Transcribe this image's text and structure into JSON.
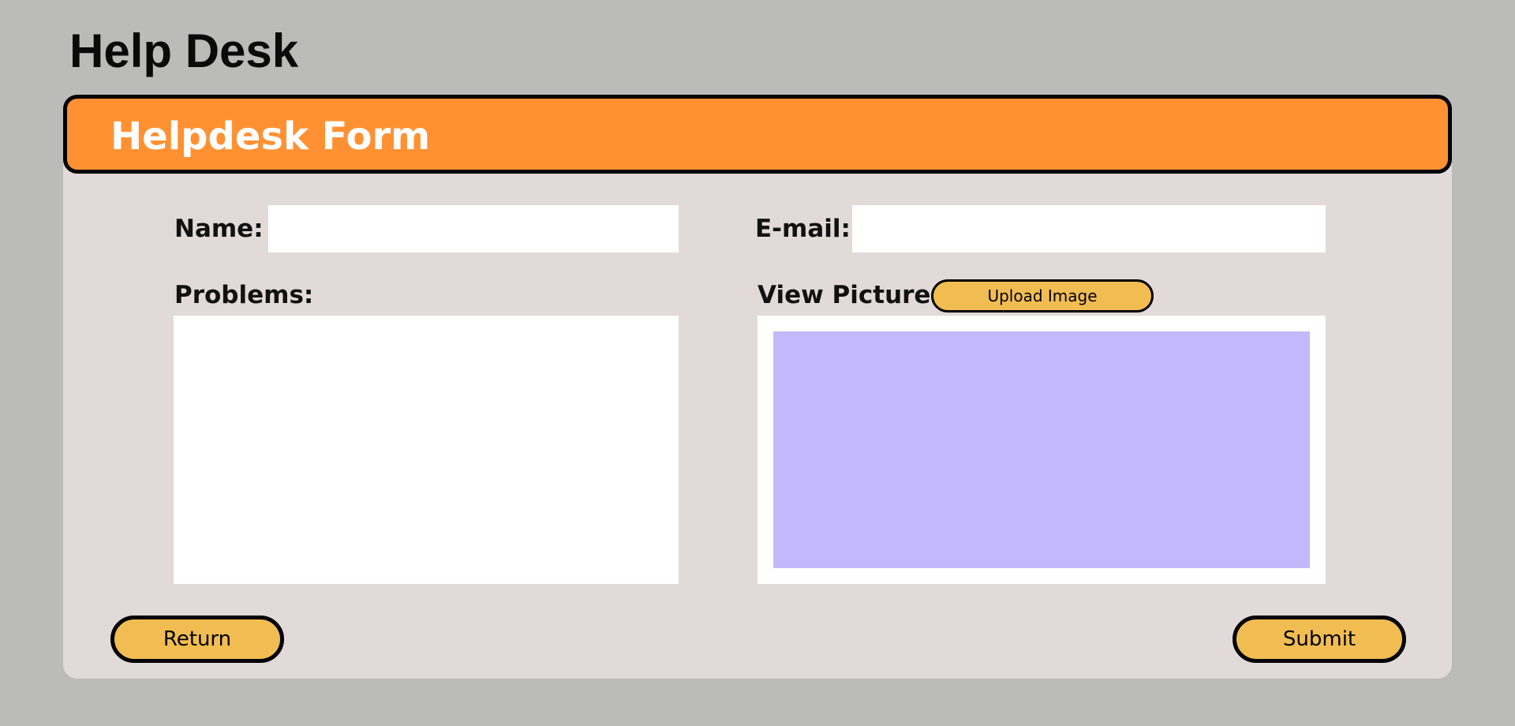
{
  "page": {
    "title": "Help Desk"
  },
  "form": {
    "header_title": "Helpdesk Form",
    "name": {
      "label": "Name:",
      "value": "",
      "placeholder": ""
    },
    "email": {
      "label": "E-mail:",
      "value": "",
      "placeholder": ""
    },
    "problems": {
      "label": "Problems:",
      "value": "",
      "placeholder": ""
    },
    "picture": {
      "label": "View Picture:",
      "upload_label": "Upload Image"
    },
    "actions": {
      "return_label": "Return",
      "submit_label": "Submit"
    }
  },
  "colors": {
    "page_background": "#bbbbb9",
    "panel_background": "#e1dad9",
    "header_background": "#ff9132",
    "button_background": "#f1bd52",
    "picture_placeholder": "#c3b8fb"
  }
}
